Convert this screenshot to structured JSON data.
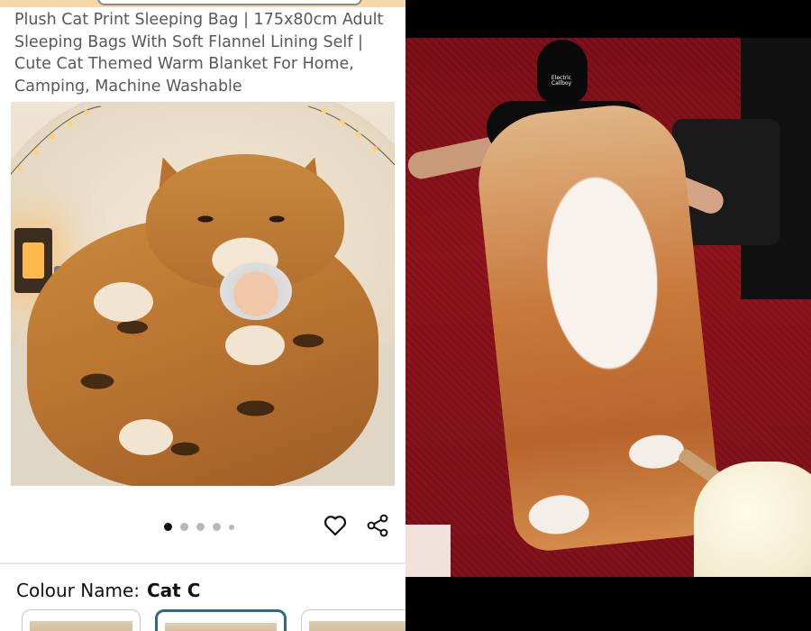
{
  "product": {
    "title": "Plush Cat Print Sleeping Bag | 175x80cm Adult Sleeping Bags With Soft Flannel Lining Self | Cute Cat Themed Warm Blanket For Home, Camping, Machine Washable"
  },
  "carousel": {
    "dots_total": 5,
    "active_index": 0
  },
  "actions": {
    "wishlist_icon": "heart-icon",
    "share_icon": "share-icon"
  },
  "variant": {
    "label": "Colour Name:",
    "value": "Cat C"
  },
  "photo_right": {
    "cap_text": "Electric Callboy"
  },
  "colors": {
    "selected_thumb_border": "#2f6a84",
    "title_text": "#565959",
    "carpet": "#8c111a"
  }
}
